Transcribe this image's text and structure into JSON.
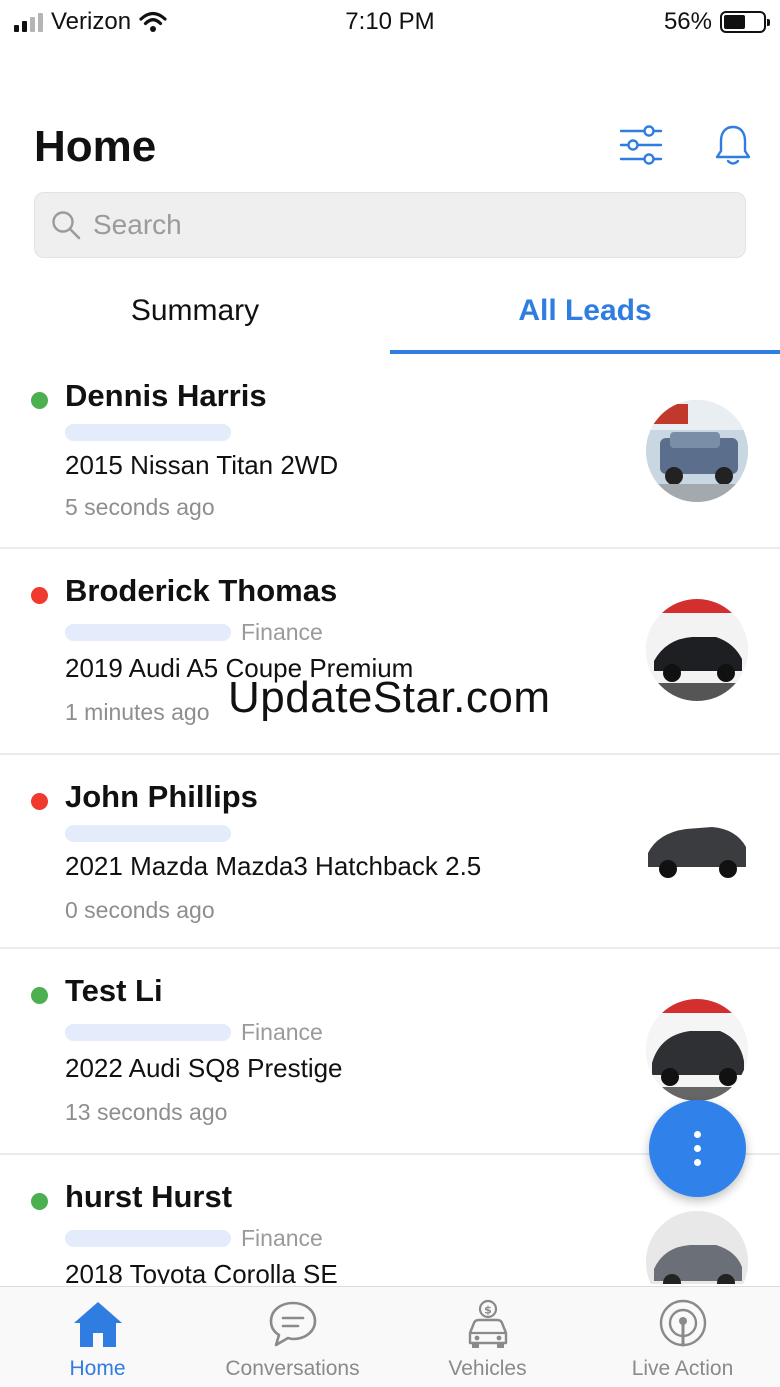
{
  "status_bar": {
    "carrier": "Verizon",
    "time": "7:10 PM",
    "battery": "56%",
    "battery_level": 0.56
  },
  "header": {
    "title": "Home"
  },
  "search": {
    "placeholder": "Search"
  },
  "tabs": [
    {
      "label": "Summary",
      "active": false
    },
    {
      "label": "All Leads",
      "active": true
    }
  ],
  "leads": [
    {
      "name": "Dennis Harris",
      "status_color": "#4caf50",
      "tag": "",
      "vehicle": "2015 Nissan Titan 2WD",
      "time": "5 seconds ago",
      "vehicle_color": "#5b6f8c"
    },
    {
      "name": "Broderick Thomas",
      "status_color": "#f03a2e",
      "tag": "Finance",
      "vehicle": "2019 Audi A5 Coupe Premium",
      "time": "1 minutes ago",
      "vehicle_color": "#1d1f22"
    },
    {
      "name": "John Phillips",
      "status_color": "#f03a2e",
      "tag": "",
      "vehicle": "2021 Mazda Mazda3 Hatchback 2.5",
      "time": "0 seconds ago",
      "vehicle_color": "#3a3c40"
    },
    {
      "name": "Test Li",
      "status_color": "#4caf50",
      "tag": "Finance",
      "vehicle": "2022 Audi SQ8 Prestige",
      "time": "13 seconds ago",
      "vehicle_color": "#2e3034"
    },
    {
      "name": "hurst Hurst",
      "status_color": "#4caf50",
      "tag": "Finance",
      "vehicle": "2018 Toyota Corolla SE",
      "time": "",
      "vehicle_color": "#6a6f78"
    }
  ],
  "watermark": "UpdateStar.com",
  "bottom_nav": [
    {
      "label": "Home",
      "icon": "home-icon",
      "active": true
    },
    {
      "label": "Conversations",
      "icon": "chat-bubble-icon",
      "active": false
    },
    {
      "label": "Vehicles",
      "icon": "car-dollar-icon",
      "active": false
    },
    {
      "label": "Live Action",
      "icon": "broadcast-icon",
      "active": false
    }
  ],
  "colors": {
    "accent": "#2f7de1",
    "fab": "#3181eb"
  }
}
